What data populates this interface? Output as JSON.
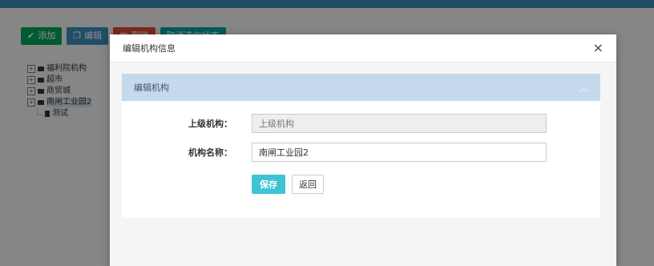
{
  "toolbar": {
    "add_label": "添加",
    "edit_label": "编辑",
    "delete_label": "删除",
    "cancel_selection_label": "取消选中状态"
  },
  "tree": {
    "items": [
      {
        "label": "福利院机构"
      },
      {
        "label": "超市"
      },
      {
        "label": "商贸城"
      },
      {
        "label": "南闸工业园2"
      }
    ],
    "child_label": "测试"
  },
  "modal": {
    "title": "编辑机构信息",
    "close_symbol": "×",
    "panel_title": "编辑机构",
    "parent_label": "上级机构：",
    "parent_placeholder": "上级机构",
    "name_label": "机构名称：",
    "name_value": "南闸工业园2",
    "save_label": "保存",
    "back_label": "返回"
  }
}
